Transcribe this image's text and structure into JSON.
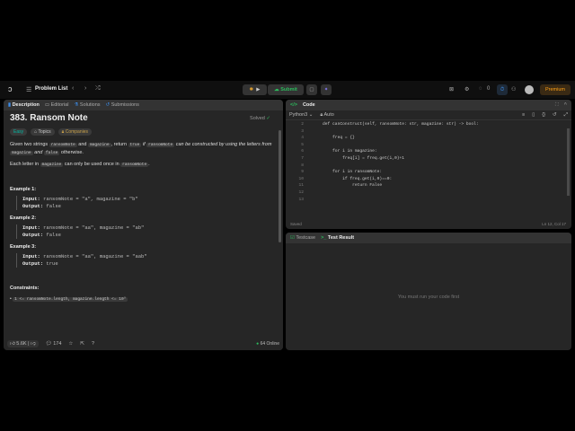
{
  "nav": {
    "problem_list": "Problem List",
    "submit": "Submit",
    "streak": "0",
    "premium": "Premium"
  },
  "left": {
    "tabs": [
      "Description",
      "Editorial",
      "Solutions",
      "Submissions"
    ],
    "title": "383. Ransom Note",
    "solved": "Solved",
    "difficulty": "Easy",
    "topics": "Topics",
    "companies": "Companies",
    "p1": {
      "a": "Given two strings ",
      "c1": "ransomNote",
      "b": " and ",
      "c2": "magazine",
      "c": ", return ",
      "c3": "true",
      "d": " if ",
      "c4": "ransomNote",
      "e": " can be constructed by using the letters from ",
      "c5": "magazine",
      "f": " and ",
      "c6": "false",
      "g": " otherwise."
    },
    "p2": {
      "a": "Each letter in ",
      "c1": "magazine",
      "b": " can only be used once in ",
      "c2": "ransomNote",
      "c": "."
    },
    "examples": [
      {
        "title": "Example 1:",
        "input_label": "Input:",
        "input": "ransomNote = \"a\", magazine = \"b\"",
        "output_label": "Output:",
        "output": "false"
      },
      {
        "title": "Example 2:",
        "input_label": "Input:",
        "input": "ransomNote = \"aa\", magazine = \"ab\"",
        "output_label": "Output:",
        "output": "false"
      },
      {
        "title": "Example 3:",
        "input_label": "Input:",
        "input": "ransomNote = \"aa\", magazine = \"aab\"",
        "output_label": "Output:",
        "output": "true"
      }
    ],
    "constraints_title": "Constraints:",
    "constraint1": "1 <= ransomNote.length, magazine.length <= 10⁵",
    "likes": "5.6K",
    "comments": "174",
    "online": "64 Online"
  },
  "code": {
    "title": "Code",
    "language": "Python3",
    "auto": "Auto",
    "saved": "Saved",
    "cursor": "Ln 12, Col 17",
    "lines": [
      {
        "n": "2",
        "t": "    def canConstruct(self, ransomNote: str, magazine: str) -> bool:"
      },
      {
        "n": "3",
        "t": ""
      },
      {
        "n": "4",
        "t": "        freq = {}"
      },
      {
        "n": "5",
        "t": ""
      },
      {
        "n": "6",
        "t": "        for i in magazine:"
      },
      {
        "n": "7",
        "t": "            freq[i] = freq.get(i,0)+1"
      },
      {
        "n": "8",
        "t": ""
      },
      {
        "n": "9",
        "t": "        for i in ransomNote:"
      },
      {
        "n": "10",
        "t": "            if freq.get(i,0)==0:"
      },
      {
        "n": "11",
        "t": "                return False"
      },
      {
        "n": "12",
        "t": ""
      },
      {
        "n": "13",
        "t": ""
      }
    ]
  },
  "test": {
    "tab_testcase": "Testcase",
    "tab_result": "Test Result",
    "message": "You must run your code first"
  }
}
